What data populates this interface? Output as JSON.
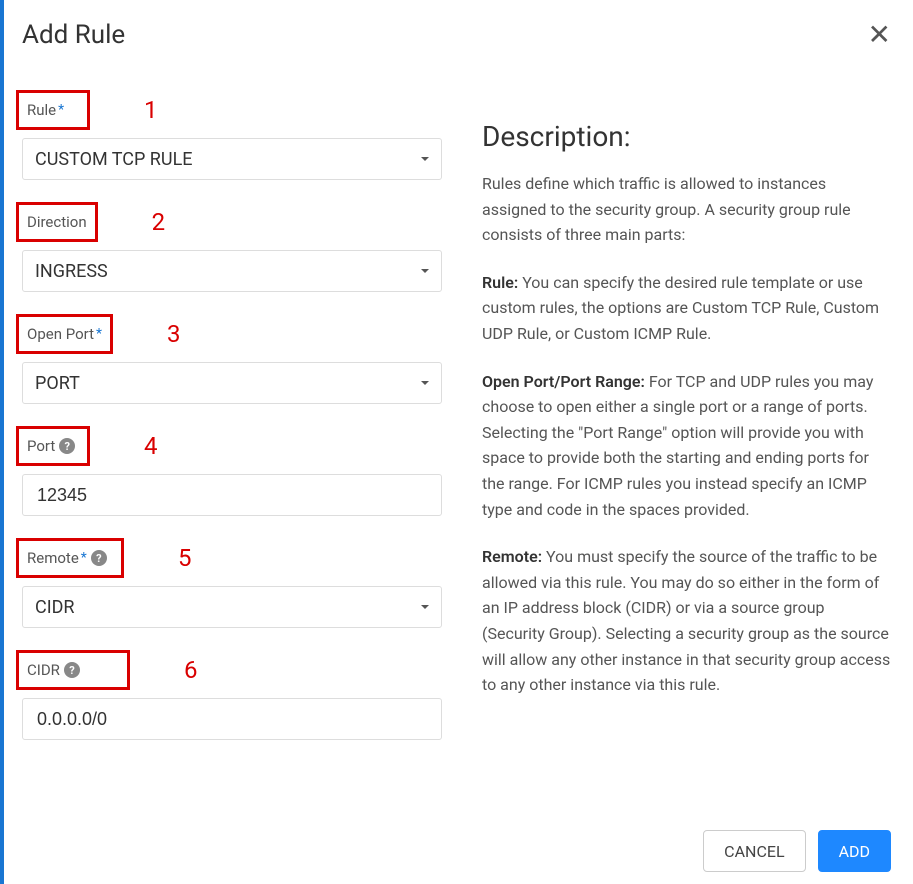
{
  "header": {
    "title": "Add Rule"
  },
  "fields": {
    "rule": {
      "label": "Rule",
      "required": true,
      "help": false,
      "number": "1",
      "value": "CUSTOM TCP RULE",
      "type": "select"
    },
    "direction": {
      "label": "Direction",
      "required": false,
      "help": false,
      "number": "2",
      "value": "INGRESS",
      "type": "select"
    },
    "open_port": {
      "label": "Open Port",
      "required": true,
      "help": false,
      "number": "3",
      "value": "PORT",
      "type": "select"
    },
    "port": {
      "label": "Port",
      "required": false,
      "help": true,
      "number": "4",
      "value": "12345",
      "type": "input"
    },
    "remote": {
      "label": "Remote",
      "required": true,
      "help": true,
      "number": "5",
      "value": "CIDR",
      "type": "select"
    },
    "cidr": {
      "label": "CIDR",
      "required": false,
      "help": true,
      "number": "6",
      "value": "0.0.0.0/0",
      "type": "input"
    }
  },
  "description": {
    "heading": "Description:",
    "intro": "Rules define which traffic is allowed to instances assigned to the security group. A security group rule consists of three main parts:",
    "rule_label": "Rule:",
    "rule_text": " You can specify the desired rule template or use custom rules, the options are Custom TCP Rule, Custom UDP Rule, or Custom ICMP Rule.",
    "port_label": "Open Port/Port Range:",
    "port_text": " For TCP and UDP rules you may choose to open either a single port or a range of ports. Selecting the \"Port Range\" option will provide you with space to provide both the starting and ending ports for the range. For ICMP rules you instead specify an ICMP type and code in the spaces provided.",
    "remote_label": "Remote:",
    "remote_text": " You must specify the source of the traffic to be allowed via this rule. You may do so either in the form of an IP address block (CIDR) or via a source group (Security Group). Selecting a security group as the source will allow any other instance in that security group access to any other instance via this rule."
  },
  "buttons": {
    "cancel": "CANCEL",
    "add": "ADD"
  }
}
